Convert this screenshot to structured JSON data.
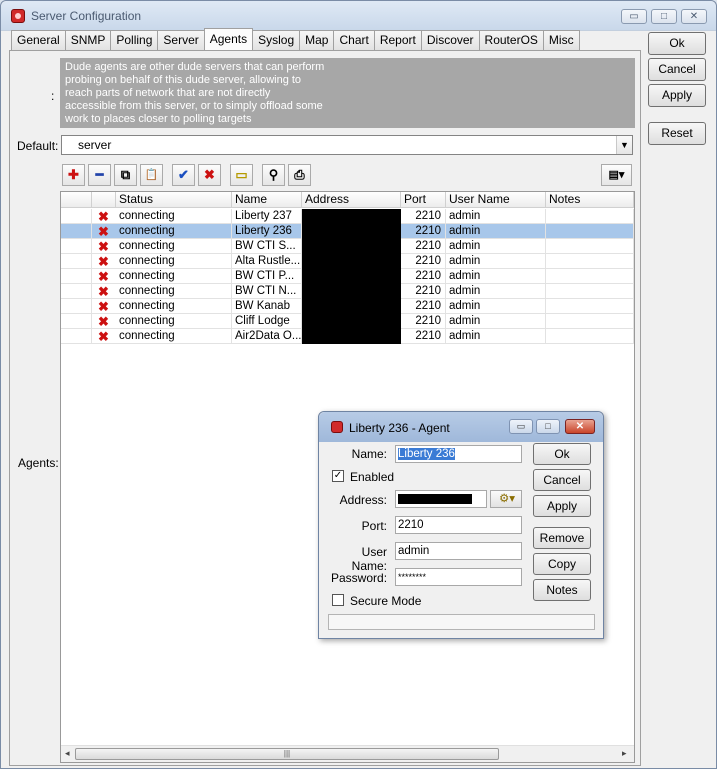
{
  "window": {
    "title": "Server Configuration",
    "controls": [
      "▭",
      "□",
      "✕"
    ]
  },
  "tabs": [
    "General",
    "SNMP",
    "Polling",
    "Server",
    "Agents",
    "Syslog",
    "Map",
    "Chart",
    "Report",
    "Discover",
    "RouterOS",
    "Misc"
  ],
  "active_tab": "Agents",
  "side_buttons": {
    "ok": "Ok",
    "cancel": "Cancel",
    "apply": "Apply",
    "reset": "Reset"
  },
  "description": {
    "colon": ":",
    "lines": [
      "Dude agents are other dude servers that can perform",
      "probing on behalf of this dude server, allowing to",
      "reach parts of network that are not directly",
      "accessible from this server, or to simply offload some",
      "work to places closer to polling targets"
    ]
  },
  "default": {
    "label": "Default:",
    "value": "server"
  },
  "toolbar": {
    "add": "✚",
    "remove": "━",
    "copy": "⧉",
    "paste": "📋",
    "enable": "✔",
    "disable": "✖",
    "comment": "▭",
    "find": "⚲",
    "print": "⎙",
    "columns": "▤▾"
  },
  "agents_label": "Agents:",
  "table": {
    "columns": [
      "",
      "",
      "Status",
      "Name",
      "Address",
      "Port",
      "User Name",
      "Notes"
    ],
    "rows": [
      {
        "status": "connecting",
        "name": "Liberty 237",
        "port": "2210",
        "user": "admin",
        "selected": false
      },
      {
        "status": "connecting",
        "name": "Liberty 236",
        "port": "2210",
        "user": "admin",
        "selected": true
      },
      {
        "status": "connecting",
        "name": "BW CTI S...",
        "port": "2210",
        "user": "admin",
        "selected": false
      },
      {
        "status": "connecting",
        "name": "Alta Rustle...",
        "port": "2210",
        "user": "admin",
        "selected": false
      },
      {
        "status": "connecting",
        "name": "BW CTI P...",
        "port": "2210",
        "user": "admin",
        "selected": false
      },
      {
        "status": "connecting",
        "name": "BW CTI N...",
        "port": "2210",
        "user": "admin",
        "selected": false
      },
      {
        "status": "connecting",
        "name": "BW Kanab",
        "port": "2210",
        "user": "admin",
        "selected": false
      },
      {
        "status": "connecting",
        "name": "Cliff Lodge",
        "port": "2210",
        "user": "admin",
        "selected": false
      },
      {
        "status": "connecting",
        "name": "Air2Data O...",
        "port": "2210",
        "user": "admin",
        "selected": false
      }
    ],
    "scroll_left": "◂",
    "scroll_right": "▸",
    "scroll_grip": "|||"
  },
  "dialog": {
    "title": "Liberty 236 - Agent",
    "controls": [
      "▭",
      "□",
      "✕"
    ],
    "name_label": "Name:",
    "name_value": "Liberty 236",
    "enabled_label": "Enabled",
    "enabled_check": "✓",
    "address_label": "Address:",
    "address_button": "⚙▾",
    "port_label": "Port:",
    "port_value": "2210",
    "user_label": "User Name:",
    "user_value": "admin",
    "password_label": "Password:",
    "password_value": "********",
    "secure_label": "Secure Mode",
    "buttons": {
      "ok": "Ok",
      "cancel": "Cancel",
      "apply": "Apply",
      "remove": "Remove",
      "copy": "Copy",
      "notes": "Notes"
    }
  }
}
